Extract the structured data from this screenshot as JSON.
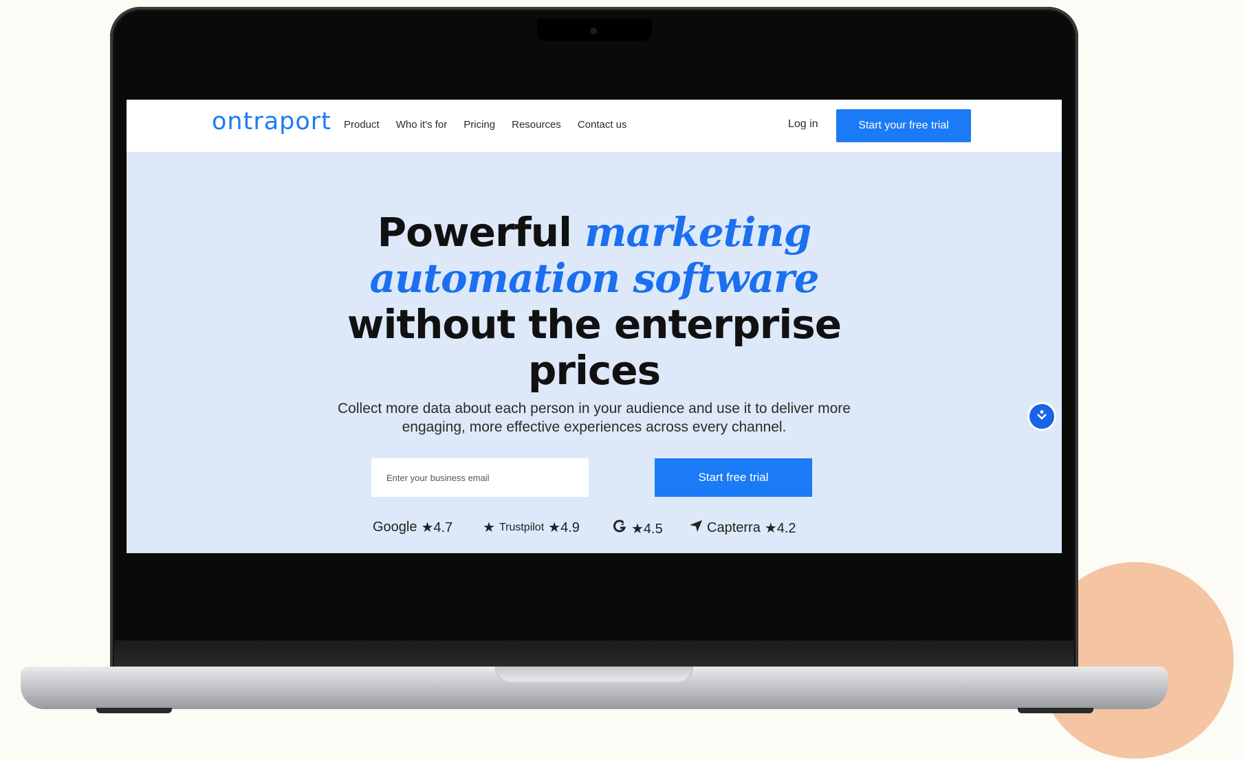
{
  "nav": {
    "logo": "ontraport",
    "links": [
      "Product",
      "Who it's for",
      "Pricing",
      "Resources",
      "Contact us"
    ],
    "login": "Log in",
    "trial_button": "Start your free trial"
  },
  "hero": {
    "headline_line1_plain": "Powerful",
    "headline_line1_accent": "marketing",
    "headline_line2_accent": "automation software",
    "headline_line3": "without the enterprise",
    "headline_line4": "prices",
    "subtext": "Collect more data about each person in your audience and use it to deliver more engaging, more effective experiences across every channel.",
    "email_placeholder": "Enter your business email",
    "cta_button": "Start free trial"
  },
  "ratings": [
    {
      "brand": "Google",
      "score": "★4.7",
      "icon": "google-wordmark"
    },
    {
      "brand": "Trustpilot",
      "score": "★4.9",
      "icon": "trustpilot-star-icon"
    },
    {
      "brand": "",
      "score": "★4.5",
      "icon": "g2-icon"
    },
    {
      "brand": "Capterra",
      "score": "★4.2",
      "icon": "capterra-icon"
    }
  ],
  "colors": {
    "accent": "#1b7af5",
    "hero_bg": "#dde9f8",
    "peach": "#f5c4a2"
  }
}
